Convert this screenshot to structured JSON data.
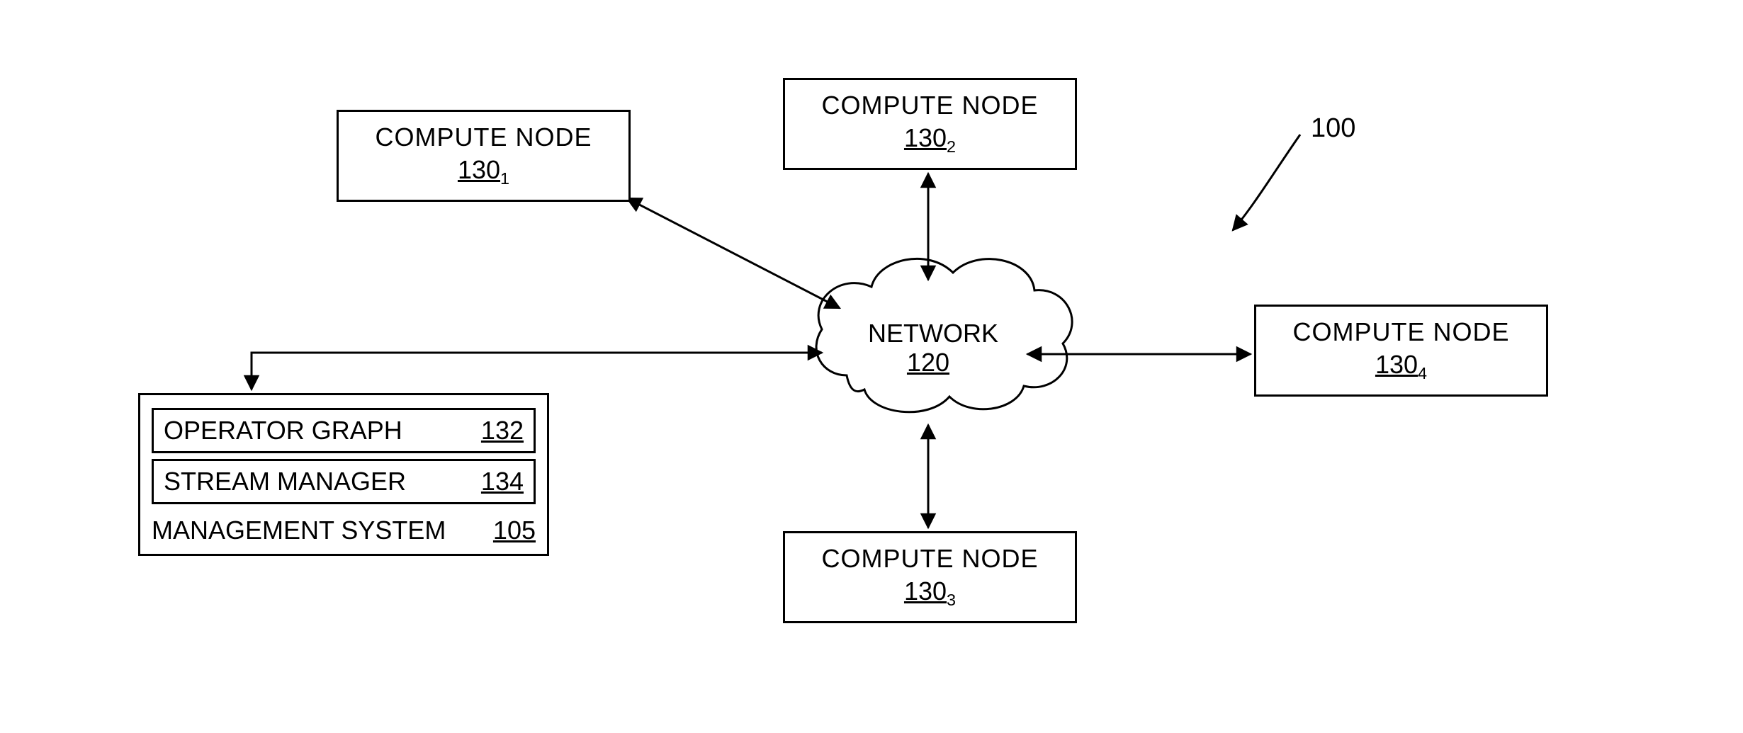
{
  "figure_ref": "100",
  "network": {
    "label": "NETWORK",
    "num": "120"
  },
  "nodes": {
    "n1": {
      "label": "COMPUTE NODE",
      "base": "130",
      "sub": "1"
    },
    "n2": {
      "label": "COMPUTE NODE",
      "base": "130",
      "sub": "2"
    },
    "n3": {
      "label": "COMPUTE NODE",
      "base": "130",
      "sub": "3"
    },
    "n4": {
      "label": "COMPUTE NODE",
      "base": "130",
      "sub": "4"
    }
  },
  "mgmt": {
    "operator_graph": {
      "label": "OPERATOR GRAPH",
      "num": "132"
    },
    "stream_manager": {
      "label": "STREAM MANAGER",
      "num": "134"
    },
    "system": {
      "label": "MANAGEMENT SYSTEM",
      "num": "105"
    }
  }
}
